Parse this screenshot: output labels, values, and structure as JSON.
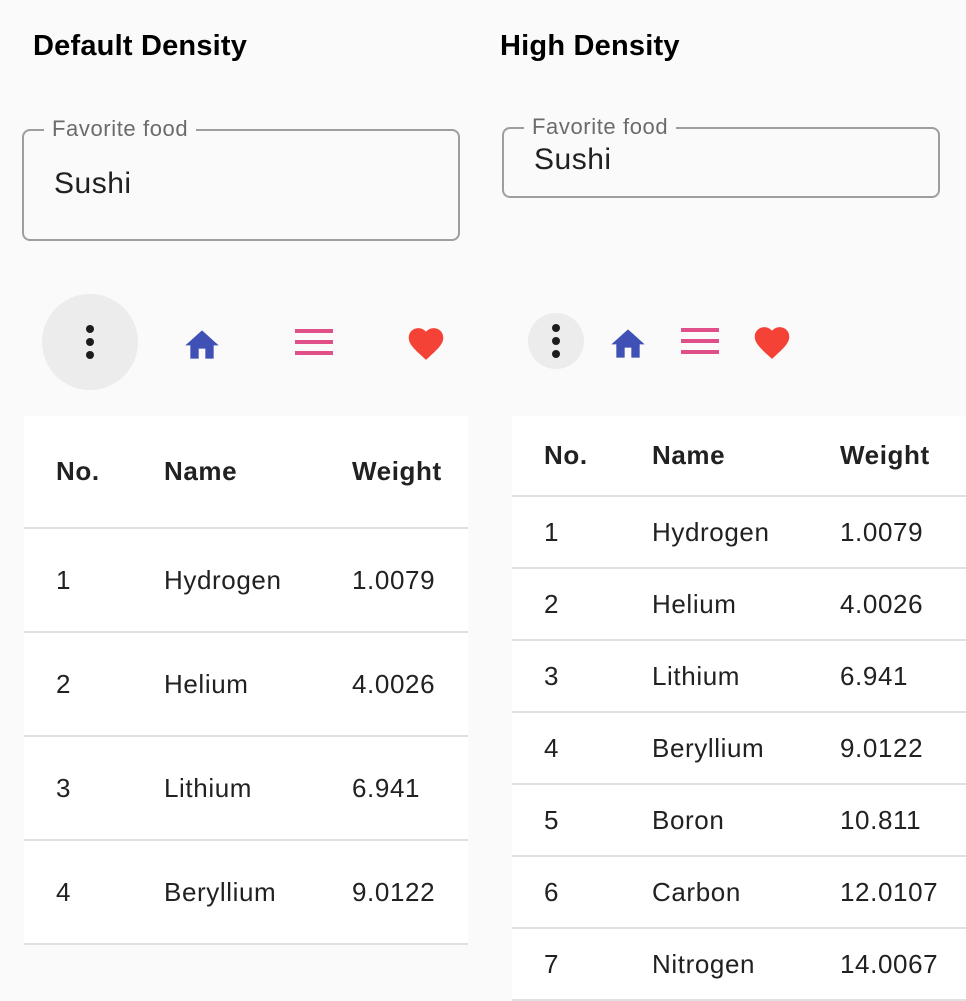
{
  "sections": [
    {
      "title": "Default Density",
      "field": {
        "label": "Favorite food",
        "value": "Sushi"
      },
      "buttons": [
        {
          "icon": "more-vert-icon"
        },
        {
          "icon": "home-icon",
          "color": "#3f51b5"
        },
        {
          "icon": "menu-icon",
          "color": "#e04f88"
        },
        {
          "icon": "heart-icon",
          "color": "#f44336"
        }
      ],
      "table": {
        "headers": [
          "No.",
          "Name",
          "Weight"
        ],
        "rows": [
          [
            "1",
            "Hydrogen",
            "1.0079"
          ],
          [
            "2",
            "Helium",
            "4.0026"
          ],
          [
            "3",
            "Lithium",
            "6.941"
          ],
          [
            "4",
            "Beryllium",
            "9.0122"
          ]
        ]
      }
    },
    {
      "title": "High Density",
      "field": {
        "label": "Favorite food",
        "value": "Sushi"
      },
      "buttons": [
        {
          "icon": "more-vert-icon"
        },
        {
          "icon": "home-icon",
          "color": "#3f51b5"
        },
        {
          "icon": "menu-icon",
          "color": "#e04f88"
        },
        {
          "icon": "heart-icon",
          "color": "#f44336"
        }
      ],
      "table": {
        "headers": [
          "No.",
          "Name",
          "Weight"
        ],
        "rows": [
          [
            "1",
            "Hydrogen",
            "1.0079"
          ],
          [
            "2",
            "Helium",
            "4.0026"
          ],
          [
            "3",
            "Lithium",
            "6.941"
          ],
          [
            "4",
            "Beryllium",
            "9.0122"
          ],
          [
            "5",
            "Boron",
            "10.811"
          ],
          [
            "6",
            "Carbon",
            "12.0107"
          ],
          [
            "7",
            "Nitrogen",
            "14.0067"
          ]
        ]
      }
    }
  ]
}
